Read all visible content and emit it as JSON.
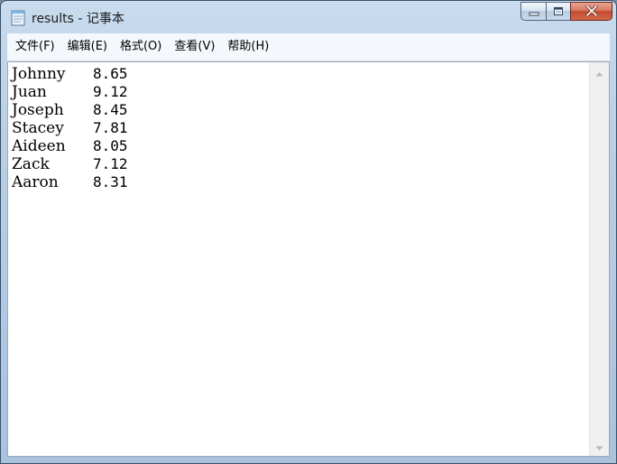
{
  "window": {
    "title": "results - 记事本"
  },
  "icons": {
    "app": "notepad-icon",
    "minimize": "minimize-icon",
    "maximize": "maximize-icon",
    "close": "close-icon",
    "scroll_up": "scroll-up-arrow-icon",
    "scroll_down": "scroll-down-arrow-icon"
  },
  "menu": {
    "file": "文件(F)",
    "edit": "编辑(E)",
    "format": "格式(O)",
    "view": "查看(V)",
    "help": "帮助(H)"
  },
  "document": {
    "rows": [
      {
        "name": "Johnny",
        "score": "8.65"
      },
      {
        "name": "Juan",
        "score": "9.12"
      },
      {
        "name": "Joseph",
        "score": "8.45"
      },
      {
        "name": "Stacey",
        "score": "7.81"
      },
      {
        "name": "Aideen",
        "score": "8.05"
      },
      {
        "name": "Zack",
        "score": "7.12"
      },
      {
        "name": "Aaron",
        "score": "8.31"
      }
    ]
  },
  "colors": {
    "close_button": "#c44a2c",
    "frame": "#b8cfe6",
    "menubar": "#f4f7fb"
  }
}
